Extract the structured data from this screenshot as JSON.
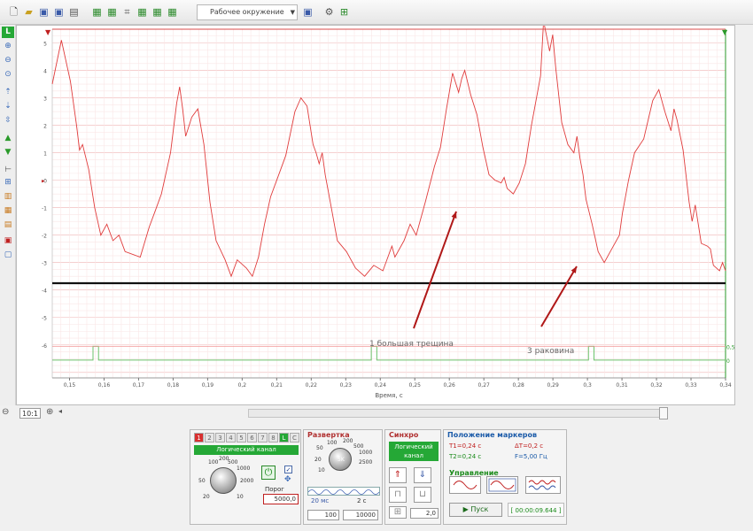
{
  "toolbar": {
    "mode_combo": "Рабочее окружение",
    "icons": [
      "new-file-icon",
      "open-folder-icon",
      "save-icon",
      "save-as-icon",
      "print-icon",
      "grid-icon",
      "grid2-icon",
      "measure-icon",
      "grid3-icon",
      "grid4-icon",
      "grid5-icon",
      "export-icon",
      "settings-icon",
      "layout-icon"
    ]
  },
  "left_toolbar": {
    "icons": [
      "channel-l-icon",
      "zoom-in-icon",
      "zoom-out-icon",
      "zoom-fit-icon",
      "arrow-up-icon",
      "arrow-down-icon",
      "scroll-icon",
      "green-up-icon",
      "green-down-icon",
      "cursor-icon",
      "marker-icon",
      "chart-icon",
      "table-icon",
      "calc-icon",
      "report-icon",
      "image-icon"
    ]
  },
  "plot": {
    "y_ticks": [
      "5",
      "4",
      "3",
      "2",
      "1",
      "0",
      "-1",
      "-2",
      "-3",
      "-4",
      "-5",
      "-6"
    ],
    "x_ticks": [
      "0,15",
      "0,16",
      "0,17",
      "0,18",
      "0,19",
      "0,2",
      "0,21",
      "0,22",
      "0,23",
      "0,24",
      "0,25",
      "0,26",
      "0,27",
      "0,28",
      "0,29",
      "0,3",
      "0,31",
      "0,32",
      "0,33",
      "0,34"
    ],
    "x_label": "Время, с",
    "annotation_1": "1 большая трещина",
    "annotation_2": "3 раковина",
    "right_tick_top": "0,5",
    "right_tick_bottom": "0",
    "colors": {
      "signal": "#e03c3c",
      "threshold_line": "#111111",
      "grid": "#f3c6c6",
      "axis": "#2a9a2a"
    }
  },
  "status": {
    "zoom": "10:1"
  },
  "channels": {
    "tabs": [
      "1",
      "2",
      "3",
      "4",
      "5",
      "6",
      "7",
      "8",
      "L",
      "С"
    ],
    "active_tab": "L",
    "name": "Логический канал",
    "knob_labels": [
      "100",
      "200",
      "500",
      "1000",
      "50",
      "2000",
      "20",
      "10"
    ],
    "threshold_label": "Порог",
    "threshold_value": "5000,0"
  },
  "sweep": {
    "title": "Развертка",
    "knob_labels": [
      "100",
      "200",
      "500",
      "1000",
      "2500",
      "5K",
      "50",
      "20",
      "10"
    ],
    "time_left": "20 мс",
    "time_right": "2 с",
    "input_1": "100",
    "input_2": "10000"
  },
  "sync": {
    "title": "Синхро",
    "button": "Логический канал",
    "value": "2,0"
  },
  "markers": {
    "title": "Положение маркеров",
    "t1": "T1=0,24 с",
    "dt": "ΔT=0,2 с",
    "t2": "T2=0,24 с",
    "f": "F=5,00 Гц",
    "control_title": "Управление",
    "start": "Пуск",
    "timer": "[ 00:00:09.644 ]"
  }
}
